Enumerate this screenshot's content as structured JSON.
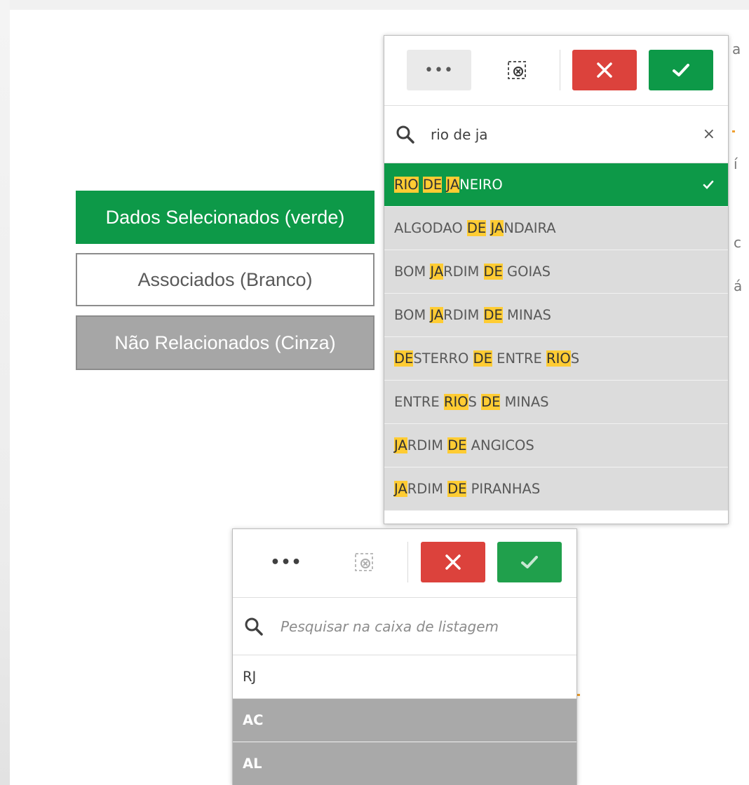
{
  "legend": {
    "selected": "Dados Selecionados (verde)",
    "associated": "Associados (Branco)",
    "not_related": "Não Relacionados (Cinza)"
  },
  "colors": {
    "selected": "#0d9948",
    "excluded": "#a6a6a6",
    "alternative": "#dcdcdc",
    "cancel": "#dc423c",
    "highlight": "#ffcc33"
  },
  "city_listbox": {
    "more_button_label": "•••",
    "search_value": "rio de ja",
    "search_clear": "×",
    "rows": [
      {
        "segments": [
          {
            "t": "RIO",
            "h": true
          },
          {
            "t": " ",
            "h": false
          },
          {
            "t": "DE",
            "h": true
          },
          {
            "t": " ",
            "h": false
          },
          {
            "t": "JA",
            "h": true
          },
          {
            "t": "NEIRO",
            "h": false
          }
        ],
        "state": "selected"
      },
      {
        "segments": [
          {
            "t": "ALGODAO ",
            "h": false
          },
          {
            "t": "DE",
            "h": true
          },
          {
            "t": " ",
            "h": false
          },
          {
            "t": "JA",
            "h": true
          },
          {
            "t": "NDAIRA",
            "h": false
          }
        ],
        "state": "alternative"
      },
      {
        "segments": [
          {
            "t": "BOM ",
            "h": false
          },
          {
            "t": "JA",
            "h": true
          },
          {
            "t": "RDIM ",
            "h": false
          },
          {
            "t": "DE",
            "h": true
          },
          {
            "t": " GOIAS",
            "h": false
          }
        ],
        "state": "alternative"
      },
      {
        "segments": [
          {
            "t": "BOM ",
            "h": false
          },
          {
            "t": "JA",
            "h": true
          },
          {
            "t": "RDIM ",
            "h": false
          },
          {
            "t": "DE",
            "h": true
          },
          {
            "t": " MINAS",
            "h": false
          }
        ],
        "state": "alternative"
      },
      {
        "segments": [
          {
            "t": "DE",
            "h": true
          },
          {
            "t": "STERRO ",
            "h": false
          },
          {
            "t": "DE",
            "h": true
          },
          {
            "t": " ENTRE ",
            "h": false
          },
          {
            "t": "RIO",
            "h": true
          },
          {
            "t": "S",
            "h": false
          }
        ],
        "state": "alternative"
      },
      {
        "segments": [
          {
            "t": "ENTRE ",
            "h": false
          },
          {
            "t": "RIO",
            "h": true
          },
          {
            "t": "S ",
            "h": false
          },
          {
            "t": "DE",
            "h": true
          },
          {
            "t": " MINAS",
            "h": false
          }
        ],
        "state": "alternative"
      },
      {
        "segments": [
          {
            "t": "JA",
            "h": true
          },
          {
            "t": "RDIM ",
            "h": false
          },
          {
            "t": "DE",
            "h": true
          },
          {
            "t": " ANGICOS",
            "h": false
          }
        ],
        "state": "alternative"
      },
      {
        "segments": [
          {
            "t": "JA",
            "h": true
          },
          {
            "t": "RDIM ",
            "h": false
          },
          {
            "t": "DE",
            "h": true
          },
          {
            "t": " PIRANHAS",
            "h": false
          }
        ],
        "state": "alternative"
      }
    ]
  },
  "state_listbox": {
    "more_button_label": "•••",
    "search_placeholder": "Pesquisar na caixa de listagem",
    "rows": [
      {
        "label": "RJ",
        "state": "possible"
      },
      {
        "label": "AC",
        "state": "excluded"
      },
      {
        "label": "AL",
        "state": "excluded"
      }
    ]
  },
  "background_fragments": [
    "a",
    "í",
    "c",
    "á"
  ]
}
